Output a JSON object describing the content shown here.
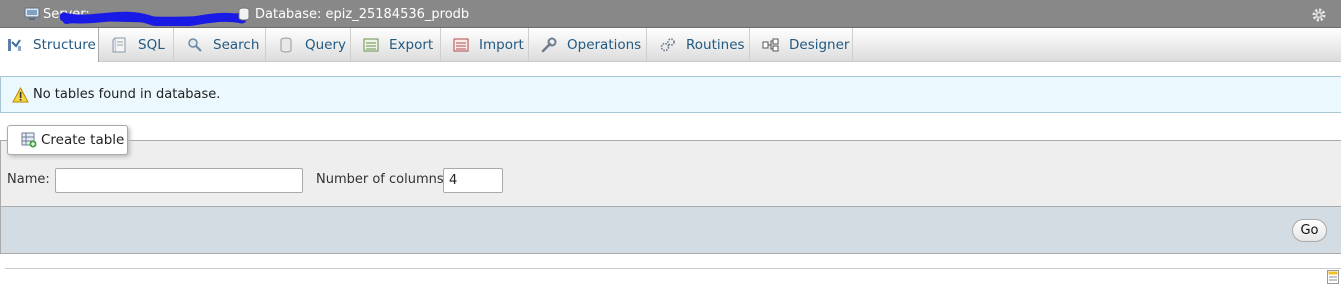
{
  "topbar": {
    "server_label": "Server:",
    "database_label": "Database: epiz_25184536_prodb",
    "server_icon": "server-icon",
    "database_icon": "database-icon",
    "settings_icon": "gear-icon"
  },
  "tabs": [
    {
      "label": "Structure",
      "icon": "structure-icon",
      "active": true
    },
    {
      "label": "SQL",
      "icon": "sql-icon"
    },
    {
      "label": "Search",
      "icon": "search-icon"
    },
    {
      "label": "Query",
      "icon": "query-icon"
    },
    {
      "label": "Export",
      "icon": "export-icon"
    },
    {
      "label": "Import",
      "icon": "import-icon"
    },
    {
      "label": "Operations",
      "icon": "wrench-icon"
    },
    {
      "label": "Routines",
      "icon": "routines-icon"
    },
    {
      "label": "Designer",
      "icon": "designer-icon"
    }
  ],
  "notice": {
    "text": "No tables found in database.",
    "icon": "warning-icon"
  },
  "create_table": {
    "legend": "Create table",
    "name_label": "Name:",
    "name_value": "",
    "columns_label": "Number of columns:",
    "columns_value": "4",
    "go_label": "Go"
  },
  "colors": {
    "topbar_bg": "#888888",
    "tab_text": "#235a81",
    "notice_bg": "#ebf8fd",
    "footer_bg": "#d3dce3"
  }
}
